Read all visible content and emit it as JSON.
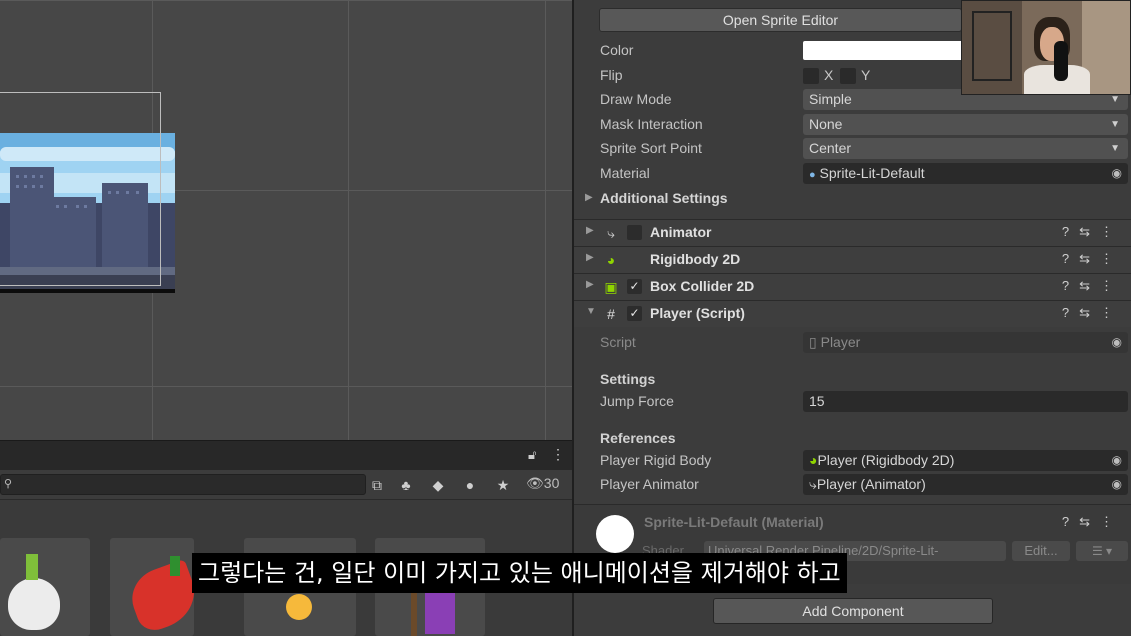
{
  "inspector": {
    "open_sprite_editor": "Open Sprite Editor",
    "color_label": "Color",
    "flip_label": "Flip",
    "flip_x": "X",
    "flip_y": "Y",
    "draw_mode_label": "Draw Mode",
    "draw_mode_value": "Simple",
    "mask_label": "Mask Interaction",
    "mask_value": "None",
    "sort_label": "Sprite Sort Point",
    "sort_value": "Center",
    "material_label": "Material",
    "material_value": "Sprite-Lit-Default",
    "additional_settings": "Additional Settings",
    "components": [
      {
        "name": "Animator",
        "enabled": false
      },
      {
        "name": "Rigidbody 2D",
        "enabled": null
      },
      {
        "name": "Box Collider 2D",
        "enabled": true
      },
      {
        "name": "Player (Script)",
        "enabled": true
      }
    ],
    "script_label": "Script",
    "script_value": "Player",
    "settings_header": "Settings",
    "jump_force_label": "Jump Force",
    "jump_force_value": "15",
    "references_header": "References",
    "rigid_body_label": "Player Rigid Body",
    "rigid_body_value": "Player (Rigidbody 2D)",
    "animator_label": "Player Animator",
    "animator_value": "Player (Animator)",
    "material_comp_name": "Sprite-Lit-Default (Material)",
    "shader_label": "Shader",
    "shader_value": "Universal Render Pipeline/2D/Sprite-Lit-",
    "edit_button": "Edit...",
    "add_component": "Add Component"
  },
  "project": {
    "hidden_count": "30"
  },
  "subtitle": "그렇다는 건, 일단 이미 가지고 있는 애니메이션을 제거해야 하고",
  "colors": {
    "accent_green": "#8fd400",
    "sky": "#9fd3f2"
  }
}
